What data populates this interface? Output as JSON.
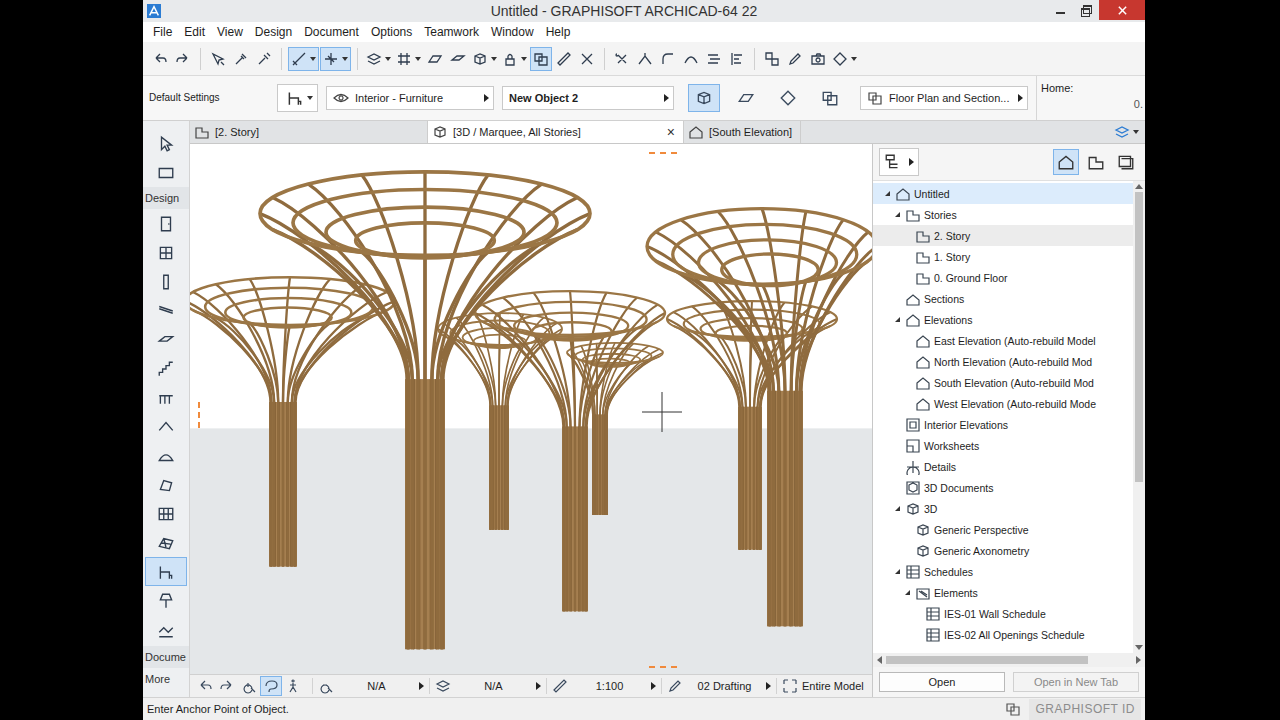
{
  "window": {
    "title": "Untitled - GRAPHISOFT ARCHICAD-64 22"
  },
  "menu": [
    "File",
    "Edit",
    "View",
    "Design",
    "Document",
    "Options",
    "Teamwork",
    "Window",
    "Help"
  ],
  "toolbar": {
    "buttons": [
      {
        "selected": false
      },
      {
        "selected": false
      },
      {
        "selected": false
      },
      {
        "selected": false
      },
      {
        "selected": false
      },
      {
        "selected": true
      },
      {
        "selected": true
      },
      {
        "selected": false
      },
      {
        "selected": false
      },
      {
        "selected": false
      },
      {
        "selected": false
      },
      {
        "selected": false
      },
      {
        "selected": false
      },
      {
        "selected": true
      },
      {
        "selected": false
      },
      {
        "selected": false
      },
      {
        "selected": false
      },
      {
        "selected": false
      },
      {
        "selected": false
      },
      {
        "selected": false
      },
      {
        "selected": false
      },
      {
        "selected": false
      },
      {
        "selected": false
      },
      {
        "selected": false
      },
      {
        "selected": false
      },
      {
        "selected": false
      }
    ]
  },
  "info_box": {
    "settings_label": "Default Settings",
    "layer": "Interior - Furniture",
    "object_name": "New Object 2",
    "view_buttons": [
      {
        "selected": true
      },
      {
        "selected": false
      },
      {
        "selected": false
      },
      {
        "selected": false
      }
    ],
    "representation": "Floor Plan and Section...",
    "home_label": "Home:",
    "home_value": "0."
  },
  "tabs": [
    {
      "label": "[2. Story]",
      "kind": "plan",
      "selected": false
    },
    {
      "label": "[3D / Marquee, All Stories]",
      "kind": "3d",
      "selected": true
    },
    {
      "label": "[South Elevation]",
      "kind": "elevation",
      "selected": false
    }
  ],
  "tab_close": "×",
  "toolbox": {
    "top_tools": [
      {
        "selected": false
      },
      {
        "selected": false
      }
    ],
    "section_label": "Design",
    "tools": [
      {
        "selected": false
      },
      {
        "selected": false
      },
      {
        "selected": false
      },
      {
        "selected": false
      },
      {
        "selected": false
      },
      {
        "selected": false
      },
      {
        "selected": false
      },
      {
        "selected": false
      },
      {
        "selected": false
      },
      {
        "selected": false
      },
      {
        "selected": false
      },
      {
        "selected": false
      },
      {
        "selected": true
      },
      {
        "selected": false
      },
      {
        "selected": false
      }
    ],
    "documents_label": "Docume",
    "more_label": "More"
  },
  "navigator": {
    "view_sets": [
      {
        "selected": true
      },
      {
        "selected": false
      },
      {
        "selected": false
      }
    ],
    "tree": [
      {
        "label": "Untitled",
        "level": 0,
        "kind": "project",
        "expandable": true,
        "expanded": true,
        "selected": true,
        "current": false
      },
      {
        "label": "Stories",
        "level": 1,
        "kind": "story-folder",
        "expandable": true,
        "expanded": true,
        "selected": false,
        "current": false
      },
      {
        "label": "2. Story",
        "level": 2,
        "kind": "story",
        "expandable": false,
        "expanded": false,
        "selected": false,
        "current": true
      },
      {
        "label": "1. Story",
        "level": 2,
        "kind": "story",
        "expandable": false,
        "expanded": false,
        "selected": false,
        "current": false
      },
      {
        "label": "0. Ground Floor",
        "level": 2,
        "kind": "story",
        "expandable": false,
        "expanded": false,
        "selected": false,
        "current": false
      },
      {
        "label": "Sections",
        "level": 1,
        "kind": "section",
        "expandable": false,
        "expanded": false,
        "selected": false,
        "current": false
      },
      {
        "label": "Elevations",
        "level": 1,
        "kind": "elevation",
        "expandable": true,
        "expanded": true,
        "selected": false,
        "current": false
      },
      {
        "label": "East Elevation (Auto-rebuild Model",
        "level": 2,
        "kind": "elevation",
        "expandable": false,
        "expanded": false,
        "selected": false,
        "current": false
      },
      {
        "label": "North Elevation (Auto-rebuild Mod",
        "level": 2,
        "kind": "elevation",
        "expandable": false,
        "expanded": false,
        "selected": false,
        "current": false
      },
      {
        "label": "South Elevation (Auto-rebuild Mod",
        "level": 2,
        "kind": "elevation",
        "expandable": false,
        "expanded": false,
        "selected": false,
        "current": false
      },
      {
        "label": "West Elevation (Auto-rebuild Mode",
        "level": 2,
        "kind": "elevation",
        "expandable": false,
        "expanded": false,
        "selected": false,
        "current": false
      },
      {
        "label": "Interior Elevations",
        "level": 1,
        "kind": "interior",
        "expandable": false,
        "expanded": false,
        "selected": false,
        "current": false
      },
      {
        "label": "Worksheets",
        "level": 1,
        "kind": "worksheet",
        "expandable": false,
        "expanded": false,
        "selected": false,
        "current": false
      },
      {
        "label": "Details",
        "level": 1,
        "kind": "detail",
        "expandable": false,
        "expanded": false,
        "selected": false,
        "current": false
      },
      {
        "label": "3D Documents",
        "level": 1,
        "kind": "document",
        "expandable": false,
        "expanded": false,
        "selected": false,
        "current": false
      },
      {
        "label": "3D",
        "level": 1,
        "kind": "3d",
        "expandable": true,
        "expanded": true,
        "selected": false,
        "current": false
      },
      {
        "label": "Generic Perspective",
        "level": 2,
        "kind": "3d",
        "expandable": false,
        "expanded": false,
        "selected": false,
        "current": false
      },
      {
        "label": "Generic Axonometry",
        "level": 2,
        "kind": "3d",
        "expandable": false,
        "expanded": false,
        "selected": false,
        "current": false
      },
      {
        "label": "Schedules",
        "level": 1,
        "kind": "schedule",
        "expandable": true,
        "expanded": true,
        "selected": false,
        "current": false
      },
      {
        "label": "Elements",
        "level": 2,
        "kind": "element-folder",
        "expandable": true,
        "expanded": true,
        "selected": false,
        "current": false
      },
      {
        "label": "IES-01 Wall Schedule",
        "level": 3,
        "kind": "schedule",
        "expandable": false,
        "expanded": false,
        "selected": false,
        "current": false
      },
      {
        "label": "IES-02 All Openings Schedule",
        "level": 3,
        "kind": "schedule",
        "expandable": false,
        "expanded": false,
        "selected": false,
        "current": false
      }
    ],
    "buttons": [
      {
        "label": "Open",
        "disabled": false
      },
      {
        "label": "Open in New Tab",
        "disabled": true
      }
    ]
  },
  "quick_options": {
    "zoom_buttons": [
      {
        "selected": false
      },
      {
        "selected": false
      },
      {
        "selected": false
      },
      {
        "selected": true
      },
      {
        "selected": false
      }
    ],
    "fields": [
      {
        "value": "N/A"
      },
      {
        "value": "N/A"
      },
      {
        "value": "1:100"
      },
      {
        "value": "02 Drafting"
      },
      {
        "value": "Entire Model"
      }
    ]
  },
  "status_bar": {
    "message": "Enter Anchor Point of Object.",
    "account": "GRAPHISOFT ID"
  }
}
